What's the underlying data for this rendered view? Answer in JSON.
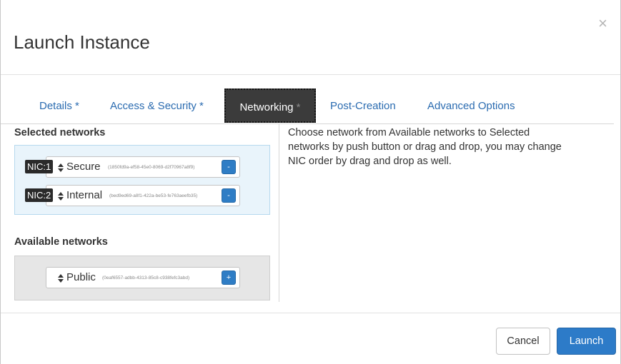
{
  "dialog": {
    "title": "Launch Instance",
    "close_glyph": "×"
  },
  "tabs": [
    {
      "label": "Details",
      "required_marker": "*",
      "active": false
    },
    {
      "label": "Access & Security",
      "required_marker": "*",
      "active": false
    },
    {
      "label": "Networking",
      "required_marker": "*",
      "active": true
    },
    {
      "label": "Post-Creation",
      "required_marker": "",
      "active": false
    },
    {
      "label": "Advanced Options",
      "required_marker": "",
      "active": false
    }
  ],
  "selected_networks": {
    "label": "Selected networks",
    "items": [
      {
        "nic": "NIC:1",
        "name": "Secure",
        "id": "(1850fd9a-ef58-45e0-8069-d2f70967a8f9)",
        "action": "-"
      },
      {
        "nic": "NIC:2",
        "name": "Internal",
        "id": "(bed9ed69-a8f1-422a-be53-fe763aeefb35)",
        "action": "-"
      }
    ]
  },
  "available_networks": {
    "label": "Available networks",
    "items": [
      {
        "name": "Public",
        "id": "(0eaf6557-adbb-4313-85c8-c938fefc3abd)",
        "action": "+"
      }
    ]
  },
  "help_text": "Choose network from Available networks to Selected networks by push button or drag and drop, you may change NIC order by drag and drop as well.",
  "footer": {
    "cancel_label": "Cancel",
    "launch_label": "Launch"
  },
  "icons": {
    "close": "close-icon",
    "sort": "sort-icon"
  },
  "colors": {
    "primary": "#2d7bc8",
    "active_tab_bg": "#3b3b3b",
    "selected_bg": "#e9f4fb",
    "available_bg": "#e6e6e6",
    "nic_badge_bg": "#2a2a2a"
  }
}
